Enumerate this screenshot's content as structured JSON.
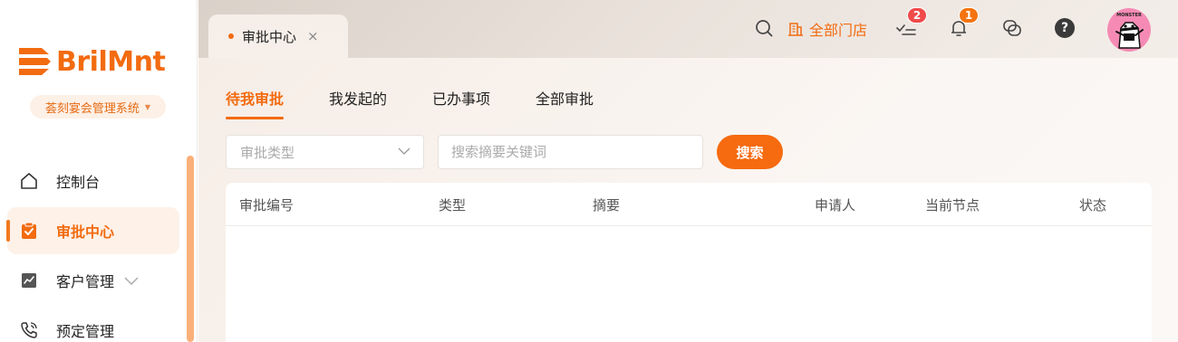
{
  "brand": {
    "logo_text": "BrilMnt",
    "system_name": "荟刻宴会管理系统",
    "accent_color": "#f26b10"
  },
  "sidebar": {
    "items": [
      {
        "label": "控制台",
        "icon": "home-icon",
        "active": false
      },
      {
        "label": "审批中心",
        "icon": "clipboard-check-icon",
        "active": true
      },
      {
        "label": "客户管理",
        "icon": "chart-icon",
        "active": false,
        "expandable": true
      },
      {
        "label": "预定管理",
        "icon": "phone-icon",
        "active": false
      }
    ]
  },
  "tabbar": {
    "page_tab": {
      "label": "审批中心",
      "close": "×"
    }
  },
  "header": {
    "store_label": "全部门店",
    "tasks_badge": "2",
    "notifications_badge": "1",
    "help_label": "?",
    "avatar_text": "MONSTER"
  },
  "content": {
    "subtabs": [
      {
        "label": "待我审批",
        "active": true
      },
      {
        "label": "我发起的",
        "active": false
      },
      {
        "label": "已办事项",
        "active": false
      },
      {
        "label": "全部审批",
        "active": false
      }
    ],
    "filter": {
      "type_placeholder": "审批类型",
      "keyword_placeholder": "搜索摘要关键词",
      "search_button": "搜索"
    },
    "table": {
      "columns": [
        "审批编号",
        "类型",
        "摘要",
        "申请人",
        "当前节点",
        "状态"
      ],
      "rows": []
    }
  }
}
